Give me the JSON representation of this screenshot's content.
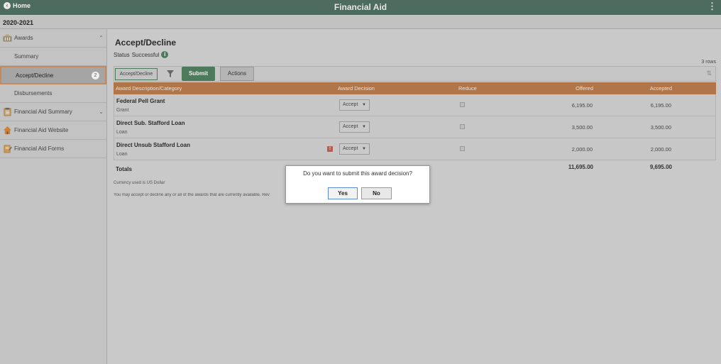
{
  "header": {
    "home_label": "Home",
    "title": "Financial Aid",
    "menu_icon": "kebab-icon"
  },
  "year": "2020-2021",
  "sidebar": {
    "items": [
      {
        "label": "Awards",
        "icon": "awards-icon",
        "expanded": true
      },
      {
        "label": "Summary"
      },
      {
        "label": "Accept/Decline",
        "badge": "2",
        "selected": true
      },
      {
        "label": "Disbursements"
      },
      {
        "label": "Financial Aid Summary",
        "icon": "clipboard-icon"
      },
      {
        "label": "Financial Aid Website",
        "icon": "house-icon"
      },
      {
        "label": "Financial Aid Forms",
        "icon": "form-icon"
      }
    ]
  },
  "main": {
    "title": "Accept/Decline",
    "status_label": "Status",
    "status_value": "Successful",
    "rows_count": "3 rows",
    "toolbar": {
      "tab_label": "Accept/Decline",
      "submit_label": "Submit",
      "actions_label": "Actions"
    },
    "grid": {
      "headers": [
        "Award Description/Category",
        "Award Decision",
        "Reduce",
        "Offered",
        "Accepted"
      ],
      "rows": [
        {
          "name": "Federal Pell Grant",
          "category": "Grant",
          "decision": "Accept",
          "offered": "6,195.00",
          "accepted": "6,195.00",
          "warning": false
        },
        {
          "name": "Direct Sub. Stafford Loan",
          "category": "Loan",
          "decision": "Accept",
          "offered": "3,500.00",
          "accepted": "3,500.00",
          "warning": false
        },
        {
          "name": "Direct Unsub Stafford Loan",
          "category": "Loan",
          "decision": "Accept",
          "offered": "2,000.00",
          "accepted": "2,000.00",
          "warning": true
        }
      ],
      "totals_label": "Totals",
      "totals_offered": "11,695.00",
      "totals_accepted": "9,695.00"
    },
    "currency_note": "Currency used is US Dollar",
    "info_note": "You may accept or decline any or all of the awards that are currently available. Rev"
  },
  "dialog": {
    "message": "Do you want to submit this award decision?",
    "yes_label": "Yes",
    "no_label": "No"
  },
  "colors": {
    "header_bg": "#4d6b5f",
    "grid_header_bg": "#b0764a",
    "accent_green": "#4d7a5a",
    "active_border": "#c68a5a"
  }
}
